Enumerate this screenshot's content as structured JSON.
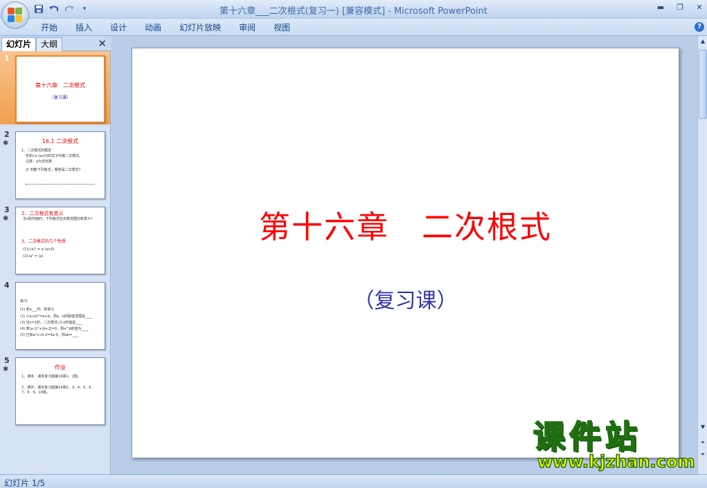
{
  "window": {
    "title": "第十六章___二次根式(复习一) [兼容模式] - Microsoft PowerPoint",
    "controls": {
      "minimize": "▬",
      "restore": "❐",
      "close": "✕"
    }
  },
  "quick_access": [
    "save-icon",
    "undo-icon",
    "redo-icon",
    "customize-icon"
  ],
  "ribbon": {
    "tabs": [
      "开始",
      "插入",
      "设计",
      "动画",
      "幻灯片放映",
      "审阅",
      "视图"
    ],
    "help": "?"
  },
  "left_pane": {
    "tab_slides": "幻灯片",
    "tab_outline": "大纲",
    "close": "✕",
    "thumbnails": [
      {
        "num": "1",
        "title": "第十六章　二次根式",
        "sub": "（复习课）",
        "anim": ""
      },
      {
        "num": "2",
        "title": "16.1  二次根式",
        "anim": "✱",
        "lines": [
          "1、二次根式的概念",
          "形如√a (a≥0)的式子叫做二次根式。",
          "注意：a为非负数",
          "2) 判断下列各式，哪些是二次根式？"
        ]
      },
      {
        "num": "3",
        "title": "2、二次根式有意义",
        "title2": "3、二次根式的几个性质",
        "anim": "✱",
        "lines": [
          "当x取何值时，下列各式在实数范围内有意义？",
          "(1)(√a)² = a (a≥0)",
          "(2)√a² = |a|"
        ]
      },
      {
        "num": "4",
        "title": "",
        "anim": "",
        "lines": [
          "练习:",
          "(1) 若a___时，有意义",
          "(2) √(a+b)²=a+b，则a、b的取值范围是____",
          "(3) 当x=1时，二次根式√2-x的值是____",
          "(4) 若(a-1)²+|b+2|=0，则a^b的值为____",
          "(5) 已知a²+√b-2=4a-4，则ab=____"
        ]
      },
      {
        "num": "5",
        "title": "作业",
        "anim": "✱",
        "lines": [
          "1、课本：课本复习题第16章1、2题。",
          "2、课外：课本复习题第16章2、3、4、5、6、7、8、9、10题。"
        ]
      }
    ]
  },
  "slide": {
    "title": "第十六章　二次根式",
    "subtitle": "（复习课）"
  },
  "watermark": {
    "brand": "课件站",
    "url": "www.kjzhan.com"
  },
  "status": {
    "slide_indicator": "幻灯片 1/5"
  },
  "colors": {
    "title_red": "#ff0000",
    "subtitle_blue": "#3333aa",
    "ribbon_text": "#15428b",
    "selected_thumb": "#f0a050"
  }
}
